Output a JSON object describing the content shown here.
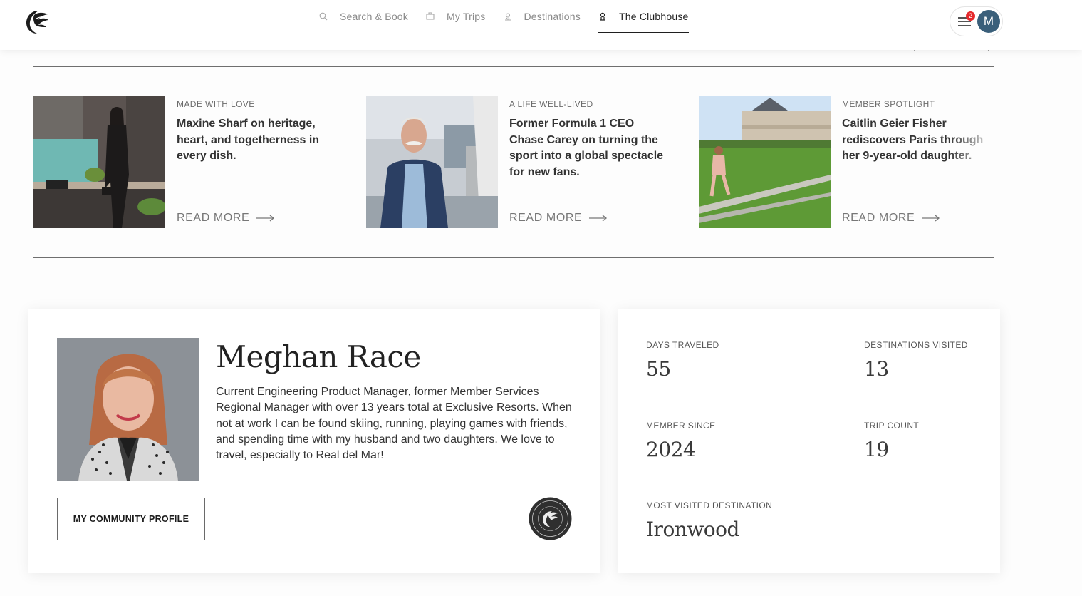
{
  "header": {
    "logo_name": "exclusive-resorts-logo",
    "nav": [
      {
        "label": "Search & Book",
        "icon": "search-icon"
      },
      {
        "label": "My Trips",
        "icon": "suitcase-icon"
      },
      {
        "label": "Destinations",
        "icon": "map-pin-icon"
      },
      {
        "label": "The Clubhouse",
        "icon": "clubhouse-icon",
        "active": true
      }
    ],
    "notifications_count": "2",
    "avatar_initial": "M"
  },
  "articles": [
    {
      "kicker": "MADE WITH LOVE",
      "headline": "Maxine Sharf on heritage, heart, and togetherness in every dish.",
      "read_more": "READ MORE"
    },
    {
      "kicker": "A LIFE WELL-LIVED",
      "headline": "Former Formula 1 CEO Chase Carey on turning the sport into a global spectacle for new fans.",
      "read_more": "READ MORE"
    },
    {
      "kicker": "MEMBER SPOTLIGHT",
      "headline": "Caitlin Geier Fisher rediscovers Paris through her 9-year-old daughter.",
      "read_more": "READ MORE"
    }
  ],
  "profile": {
    "name": "Meghan Race",
    "bio": "Current Engineering Product Manager, former Member Services Regional Manager with over 13 years total at Exclusive Resorts. When not at work I can be found skiing, running, playing games with friends, and spending time with my husband and two daughters. We love to travel, especially to Real del Mar!",
    "button_label": "MY COMMUNITY PROFILE"
  },
  "stats": {
    "days_traveled": {
      "label": "DAYS TRAVELED",
      "value": "55"
    },
    "destinations_visited": {
      "label": "DESTINATIONS VISITED",
      "value": "13"
    },
    "member_since": {
      "label": "MEMBER SINCE",
      "value": "2024"
    },
    "trip_count": {
      "label": "TRIP COUNT",
      "value": "19"
    },
    "most_visited": {
      "label": "MOST VISITED DESTINATION",
      "value": "Ironwood"
    }
  },
  "colors": {
    "accent_dark": "#1f1f1f",
    "badge_red": "#e5292c",
    "avatar_blue": "#3a5f7a"
  }
}
